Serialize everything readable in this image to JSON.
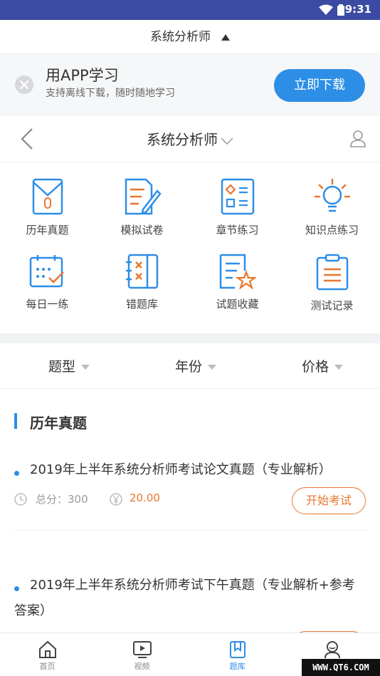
{
  "status_bar": {
    "time": "9:31"
  },
  "top_bar": {
    "title": "系统分析师"
  },
  "banner": {
    "title": "用APP学习",
    "subtitle": "支持离线下载，随时随地学习",
    "button": "立即下载"
  },
  "subject_header": {
    "title": "系统分析师"
  },
  "grid_items": [
    {
      "label": "历年真题",
      "icon": "folder-icon"
    },
    {
      "label": "模拟试卷",
      "icon": "paper-pencil-icon"
    },
    {
      "label": "章节练习",
      "icon": "checklist-icon"
    },
    {
      "label": "知识点练习",
      "icon": "lightbulb-icon"
    },
    {
      "label": "每日一练",
      "icon": "calendar-icon"
    },
    {
      "label": "错题库",
      "icon": "wrong-book-icon"
    },
    {
      "label": "试题收藏",
      "icon": "star-doc-icon"
    },
    {
      "label": "测试记录",
      "icon": "clipboard-icon"
    }
  ],
  "filters": [
    {
      "label": "题型"
    },
    {
      "label": "年份"
    },
    {
      "label": "价格"
    }
  ],
  "section": {
    "title": "历年真题"
  },
  "exams": [
    {
      "title": "2019年上半年系统分析师考试论文真题（专业解析）",
      "score_label": "总分：300",
      "price": "20.00",
      "button": "开始考试"
    },
    {
      "title": "2019年上半年系统分析师考试下午真题（专业解析+参考答案）",
      "score_label": "",
      "price": "",
      "button": ""
    }
  ],
  "tab_bar": [
    {
      "label": "首页",
      "icon": "home-icon"
    },
    {
      "label": "视频",
      "icon": "video-icon"
    },
    {
      "label": "题库",
      "icon": "bookmark-icon"
    },
    {
      "label": "",
      "icon": "profile-icon"
    }
  ],
  "watermark": "WWW.QT6.COM",
  "colors": {
    "primary": "#2d8ee6",
    "accent": "#e8772f",
    "status_bar": "#3b4ba3"
  }
}
